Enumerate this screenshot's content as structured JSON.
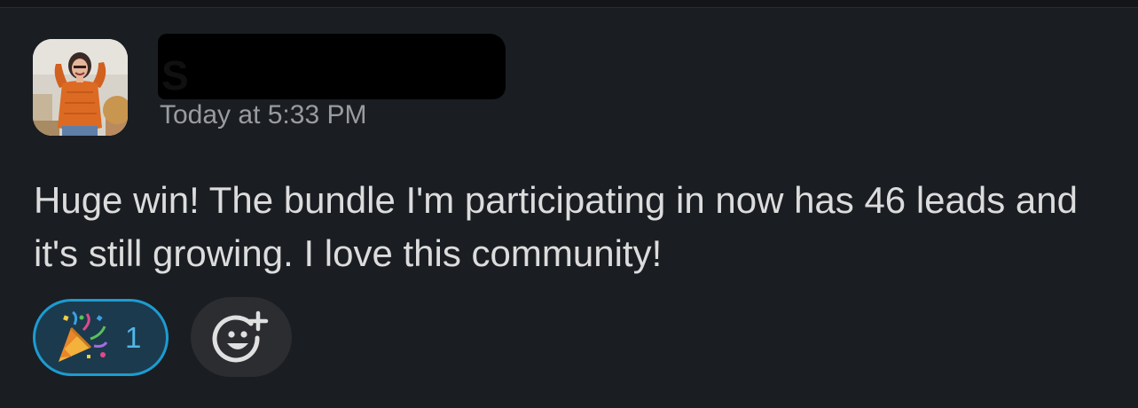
{
  "message": {
    "author_name_redacted": "S",
    "timestamp": "Today at 5:33 PM",
    "text": "Huge win! The bundle I'm participating in now has 46 leads and it's still growing. I love this community!"
  },
  "reactions": [
    {
      "emoji": "party-popper-icon",
      "count": "1",
      "selected": true
    }
  ],
  "add_reaction": {
    "icon": "add-reaction-icon"
  },
  "colors": {
    "background": "#1a1d21",
    "text": "#dcdcdd",
    "timestamp": "#9a9b9e",
    "reaction_border": "#1d9bd1",
    "reaction_bg": "#1c3a4d",
    "reaction_count": "#4fb6e8",
    "add_reaction_bg": "#2b2d31"
  }
}
